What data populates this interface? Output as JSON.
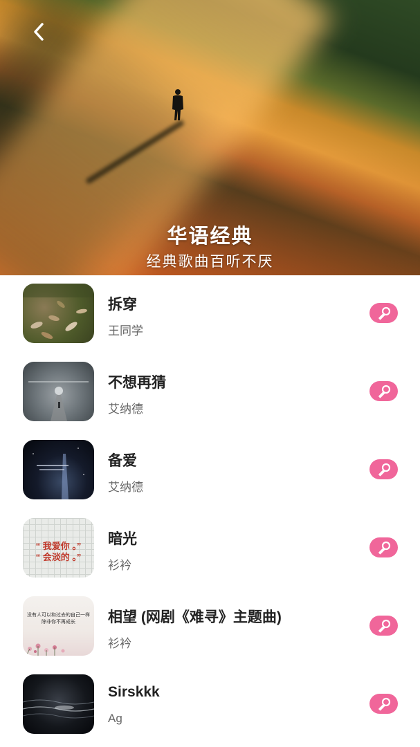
{
  "header": {
    "title": "华语经典",
    "subtitle": "经典歌曲百听不厌"
  },
  "songs": [
    {
      "title": "拆穿",
      "artist": "王同学"
    },
    {
      "title": "不想再猜",
      "artist": "艾纳德"
    },
    {
      "title": "备爱",
      "artist": "艾纳德"
    },
    {
      "title": "暗光",
      "artist": "衫衿"
    },
    {
      "title": "相望 (网剧《难寻》主题曲)",
      "artist": "衫衿"
    },
    {
      "title": "Sirskkk",
      "artist": "Ag"
    }
  ],
  "covers": {
    "cover_4_line1": "“ 我爱你 。”",
    "cover_4_line2": "“ 会淡的 。”",
    "cover_5_line1": "没有人可以和过去的自己一样",
    "cover_5_line2": "除非你不再成长"
  },
  "colors": {
    "accent": "#f0669a",
    "title_text": "#222222",
    "artist_text": "#666666"
  },
  "icons": {
    "back": "chevron-left-icon",
    "sing": "microphone-icon"
  }
}
